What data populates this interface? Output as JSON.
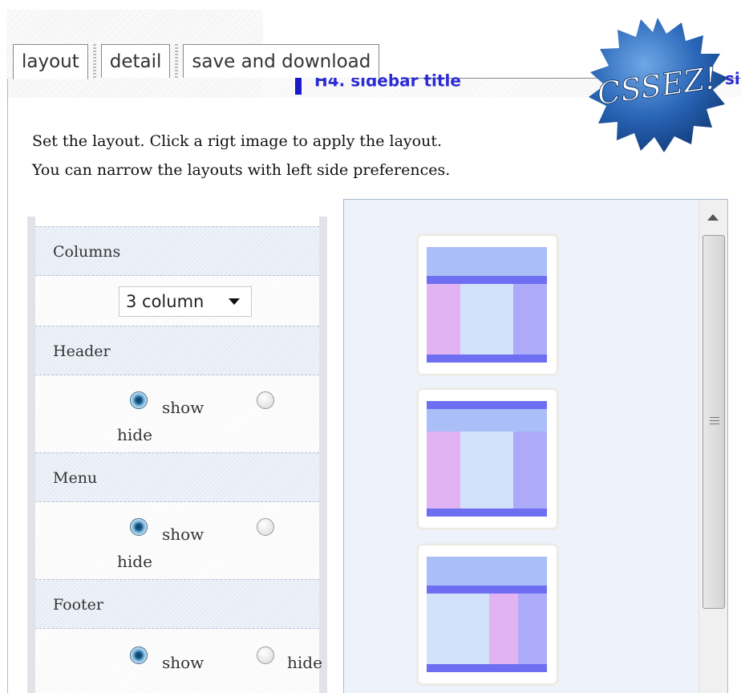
{
  "tabs": [
    {
      "label": "layout",
      "active": true
    },
    {
      "label": "detail",
      "active": false
    },
    {
      "label": "save and download",
      "active": false
    }
  ],
  "header": {
    "sidebar_title": "H4. sidebar title",
    "sidebar_title_clip": "si",
    "badge_text": "CSSEZ!"
  },
  "intro": {
    "line1": "Set the layout. Click a rigt image to apply the layout.",
    "line2": "You can narrow the layouts with left side preferences."
  },
  "prefs": {
    "columns": {
      "label": "Columns",
      "selected": "3 column"
    },
    "header": {
      "label": "Header",
      "show": "show",
      "hide": "hide",
      "value": "show"
    },
    "menu": {
      "label": "Menu",
      "show": "show",
      "hide": "hide",
      "value": "show"
    },
    "footer": {
      "label": "Footer",
      "show": "show",
      "hide": "hide",
      "value": "show"
    }
  },
  "layouts": [
    {
      "name": "layout-1"
    },
    {
      "name": "layout-2"
    },
    {
      "name": "layout-3"
    }
  ],
  "colors": {
    "accent": "#1a1ac8",
    "header_block": "#aabff8",
    "bar_block": "#6e6ef2",
    "side_pink": "#e2b3f2",
    "side_purple": "#aeaafa",
    "main_block": "#d3e2fb",
    "badge": "#1e5aa8"
  }
}
